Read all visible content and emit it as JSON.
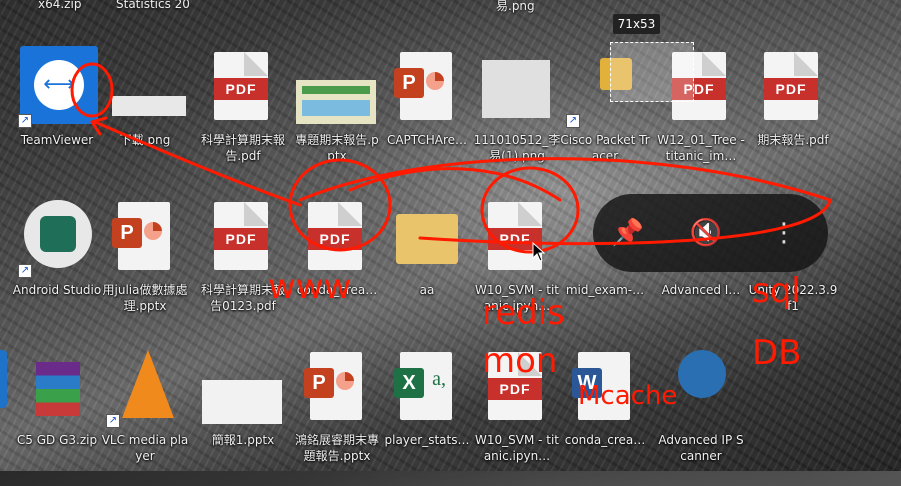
{
  "overlay": {
    "tooltip": "71x53",
    "toolbar_icons": [
      "pin-icon",
      "mute-icon",
      "more-icon"
    ]
  },
  "desktop": {
    "top_labels": [
      "x64.zip",
      "Statistics 20",
      "易.png"
    ],
    "row1": [
      {
        "label": "TeamViewer",
        "type": "app"
      },
      {
        "label": "下載.png",
        "type": "png"
      },
      {
        "label": "科學計算期末報告.pdf",
        "type": "pdf",
        "badge": "PDF"
      },
      {
        "label": "專題期末報告.pptx",
        "type": "pptx"
      },
      {
        "label": "CAPTCHAre…",
        "type": "pptx"
      },
      {
        "label": "111010512_李易(1).png",
        "type": "png"
      },
      {
        "label": "Cisco Packet Tracer",
        "type": "app"
      },
      {
        "label": "W12_01_Tree - titanic_im…",
        "type": "pdf",
        "badge": "PDF"
      },
      {
        "label": "期末報告.pdf",
        "type": "pdf",
        "badge": "PDF"
      }
    ],
    "row2": [
      {
        "label": "Android Studio",
        "type": "app"
      },
      {
        "label": "用julia做數據處理.pptx",
        "type": "pptx"
      },
      {
        "label": "科學計算期末報告0123.pdf",
        "type": "pdf",
        "badge": "PDF"
      },
      {
        "label": "conda_crea…",
        "type": "pdf",
        "badge": "PDF"
      },
      {
        "label": "aa",
        "type": "folder"
      },
      {
        "label": "W10_SVM - titanic.ipyn…",
        "type": "pdf",
        "badge": "PDF"
      },
      {
        "label": "mid_exam-…",
        "type": "file"
      },
      {
        "label": "Advanced I…",
        "type": "app"
      },
      {
        "label": "Unity 2022.3.9f1",
        "type": "app"
      }
    ],
    "row3": [
      {
        "label": "C5 GD G3.zip",
        "type": "zip"
      },
      {
        "label": "VLC media player",
        "type": "app"
      },
      {
        "label": "簡報1.pptx",
        "type": "pptx"
      },
      {
        "label": "鴻銘展睿期末專題報告.pptx",
        "type": "pptx"
      },
      {
        "label": "player_stats…",
        "type": "xlsx"
      },
      {
        "label": "W10_SVM - titanic.ipyn…",
        "type": "pdf",
        "badge": "PDF"
      },
      {
        "label": "conda_crea…",
        "type": "docx"
      },
      {
        "label": "Advanced IP Scanner",
        "type": "app"
      }
    ]
  },
  "annotations": {
    "words": [
      "www",
      "redis",
      "mon",
      "Mcache",
      "sql",
      "DB"
    ],
    "color": "#ff1a00"
  }
}
